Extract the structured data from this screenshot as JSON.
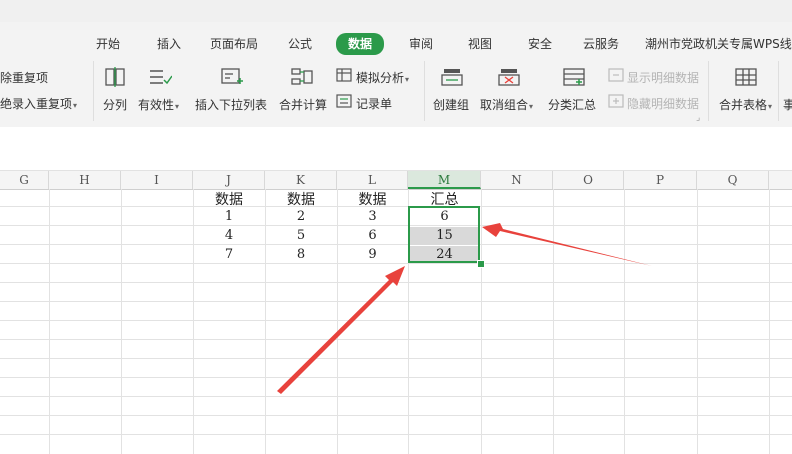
{
  "ribbon_tabs": [
    "开始",
    "插入",
    "页面布局",
    "公式",
    "数据",
    "审阅",
    "视图",
    "安全",
    "云服务",
    "潮州市党政机关专属WPS线上"
  ],
  "active_tab": "数据",
  "toolbar": {
    "remove_dup": "除重复项",
    "reject_dup": "绝录入重复项",
    "split": "分列",
    "validity": "有效性",
    "dropdown": "插入下拉列表",
    "consolidate": "合并计算",
    "whatif": "模拟分析",
    "record": "记录单",
    "group": "创建组",
    "ungroup": "取消组合",
    "subtotal": "分类汇总",
    "show_detail": "显示明细数据",
    "hide_detail": "隐藏明细数据",
    "merge_tables": "合并表格"
  },
  "columns": [
    "G",
    "H",
    "I",
    "J",
    "K",
    "L",
    "M",
    "N",
    "O",
    "P",
    "Q"
  ],
  "selected_column": "M",
  "table": {
    "headers": [
      "数据",
      "数据",
      "数据",
      "汇总"
    ],
    "rows": [
      [
        "1",
        "2",
        "3",
        "6"
      ],
      [
        "4",
        "5",
        "6",
        "15"
      ],
      [
        "7",
        "8",
        "9",
        "24"
      ]
    ]
  },
  "colors": {
    "accent": "#2b9a4a",
    "arrow": "#e8423c"
  }
}
